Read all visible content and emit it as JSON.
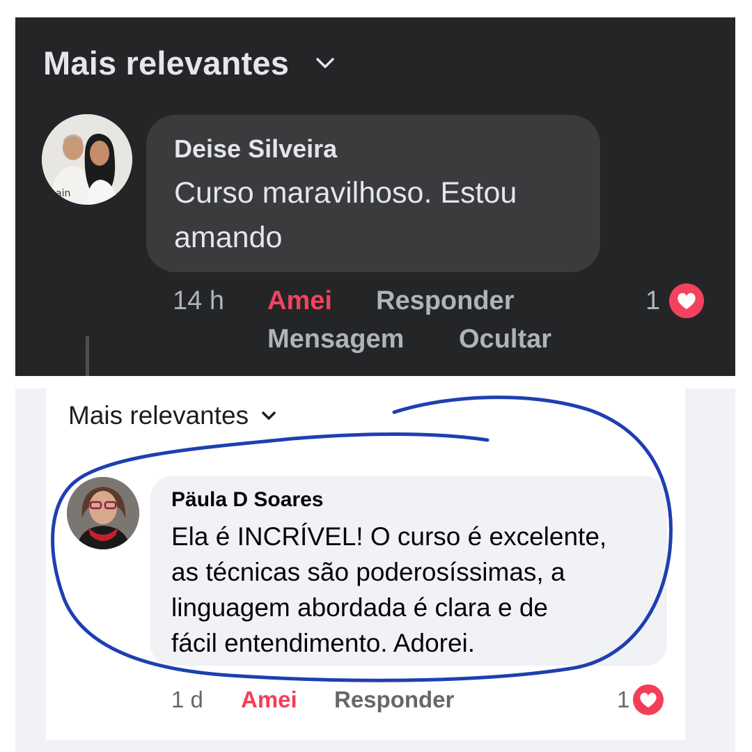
{
  "top": {
    "sort_label": "Mais relevantes",
    "comment": {
      "author": "Deise Silveira",
      "text_line1": "Curso maravilhoso.  Estou",
      "text_line2": "amando",
      "time": "14 h",
      "reaction_label": "Amei",
      "reply_label": "Responder",
      "message_label": "Mensagem",
      "hide_label": "Ocultar",
      "reaction_count": "1",
      "reaction_type": "heart"
    }
  },
  "bottom": {
    "sort_label": "Mais relevantes",
    "comment": {
      "author": "Päula D Soares",
      "text_line1": "Ela é INCRÍVEL! O curso é excelente,",
      "text_line2": "as técnicas são poderosíssimas, a",
      "text_line3": "linguagem abordada é clara e  de",
      "text_line4": "fácil entendimento. Adorei.",
      "time": "1 d",
      "reaction_label": "Amei",
      "reply_label": "Responder",
      "reaction_count": "1",
      "reaction_type": "heart"
    }
  },
  "colors": {
    "dark_bg": "#242526",
    "dark_bubble": "#3a3b3c",
    "love_red": "#f3425f",
    "annotation_blue": "#1e3fb0"
  },
  "icons": {
    "sort_chevron": "chevron-down-icon",
    "reaction": "heart-icon"
  }
}
